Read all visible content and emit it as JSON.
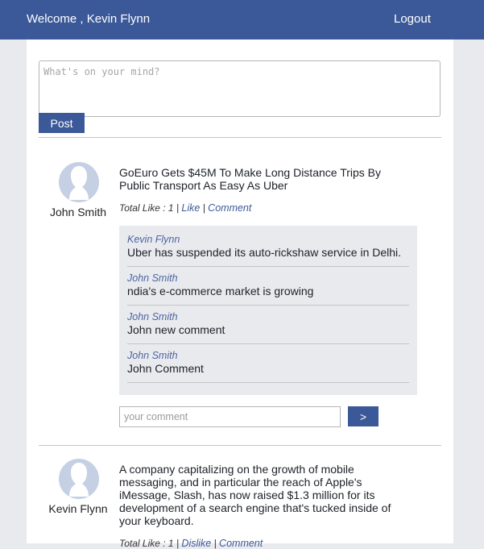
{
  "header": {
    "welcome": "Welcome , Kevin Flynn",
    "logout": "Logout"
  },
  "composer": {
    "placeholder": "What's on your mind?",
    "post_label": "Post"
  },
  "posts": [
    {
      "author": "John Smith",
      "text": "GoEuro Gets $45M To Make Long Distance Trips By Public Transport As Easy As Uber",
      "total_like": "Total Like : 1",
      "sep": "|",
      "action": "Like",
      "comment_link": "Comment",
      "comments": [
        {
          "author": "Kevin Flynn",
          "text": "Uber has suspended its auto-rickshaw service in Delhi."
        },
        {
          "author": "John Smith",
          "text": "ndia's e-commerce market is growing"
        },
        {
          "author": "John Smith",
          "text": "John new comment"
        },
        {
          "author": "John Smith",
          "text": "John Comment"
        }
      ],
      "comment_placeholder": "your comment",
      "submit_label": ">"
    },
    {
      "author": "Kevin Flynn",
      "text": "A company capitalizing on the growth of mobile messaging, and in particular the reach of Apple's iMessage, Slash, has now raised $1.3 million for its development of a search engine that's tucked inside of your keyboard.",
      "total_like": "Total Like : 1",
      "sep": "|",
      "action": "Dislike",
      "comment_link": "Comment"
    }
  ],
  "icons": {
    "avatar": "user-silhouette-icon"
  },
  "colors": {
    "brand": "#3b5998",
    "background": "#e9eaee",
    "comment_box": "#e9eaee"
  }
}
